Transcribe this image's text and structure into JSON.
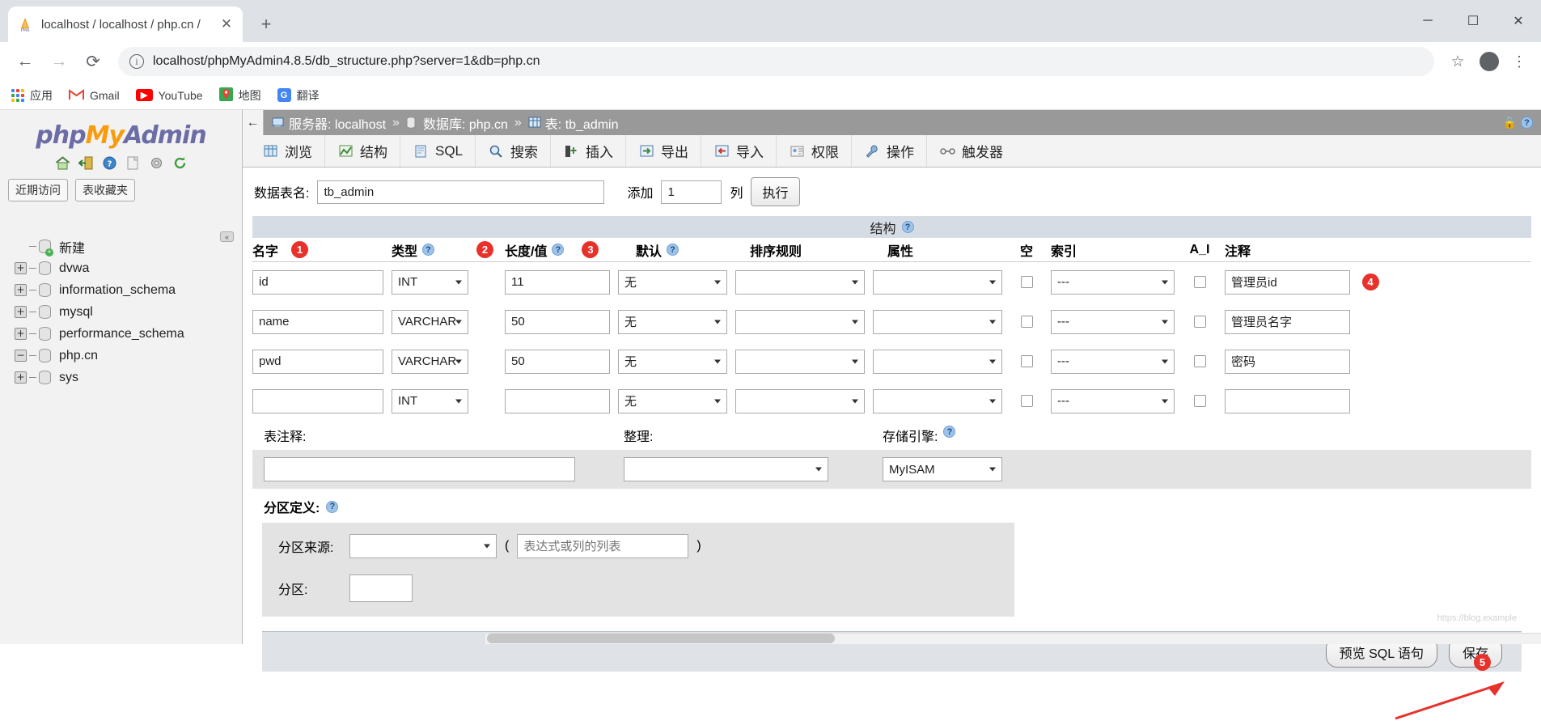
{
  "browser": {
    "tab": {
      "title": "localhost / localhost / php.cn /",
      "favicon": "pma-logo-icon",
      "close": "✕"
    },
    "new_tab": "+",
    "window_controls": {
      "minimize": "─",
      "maximize": "☐",
      "close": "✕"
    },
    "nav": {
      "back": "←",
      "forward": "→",
      "reload": "⟳"
    },
    "omnibox": {
      "info_icon": "i",
      "url_prefix": "localhost/",
      "url_rest": "phpMyAdmin4.8.5/db_structure.php?server=1&db=php.cn",
      "full_url": "localhost/phpMyAdmin4.8.5/db_structure.php?server=1&db=php.cn",
      "star": "☆"
    },
    "bookmarks": [
      {
        "label": "应用",
        "icon": "apps-grid-icon"
      },
      {
        "label": "Gmail",
        "icon": "gmail-icon"
      },
      {
        "label": "YouTube",
        "icon": "youtube-icon"
      },
      {
        "label": "地图",
        "icon": "maps-icon"
      },
      {
        "label": "翻译",
        "icon": "translate-icon"
      }
    ]
  },
  "sidebar": {
    "logo_php": "php",
    "logo_my": "My",
    "logo_admin": "Admin",
    "icons": [
      {
        "name": "home-icon",
        "glyph": "🏠"
      },
      {
        "name": "logout-icon",
        "glyph": "➡"
      },
      {
        "name": "help-icon",
        "glyph": "?"
      },
      {
        "name": "docs-icon",
        "glyph": "🗎"
      },
      {
        "name": "settings-icon",
        "glyph": "⚙"
      },
      {
        "name": "reload-icon",
        "glyph": "↻"
      }
    ],
    "buttons": [
      "近期访问",
      "表收藏夹"
    ],
    "collapse_toggle": "«",
    "tree": [
      {
        "label": "新建",
        "expander": "none",
        "icon": "db-new-icon"
      },
      {
        "label": "dvwa",
        "expander": "plus",
        "icon": "db-icon"
      },
      {
        "label": "information_schema",
        "expander": "plus",
        "icon": "db-icon"
      },
      {
        "label": "mysql",
        "expander": "plus",
        "icon": "db-icon"
      },
      {
        "label": "performance_schema",
        "expander": "plus",
        "icon": "db-icon"
      },
      {
        "label": "php.cn",
        "expander": "minus",
        "icon": "db-icon"
      },
      {
        "label": "sys",
        "expander": "plus",
        "icon": "db-icon"
      }
    ]
  },
  "breadcrumb": {
    "back": "←",
    "server_label": "服务器: localhost",
    "sep1": "»",
    "db_label": "数据库: php.cn",
    "sep2": "»",
    "table_label": "表: tb_admin",
    "lock_icon": "🔒",
    "help_icon": "?"
  },
  "tabs": [
    {
      "label": "浏览",
      "icon": "browse-icon",
      "glyph": "▤"
    },
    {
      "label": "结构",
      "icon": "structure-icon",
      "glyph": "▦"
    },
    {
      "label": "SQL",
      "icon": "sql-icon",
      "glyph": "▧"
    },
    {
      "label": "搜索",
      "icon": "search-icon",
      "glyph": "🔍"
    },
    {
      "label": "插入",
      "icon": "insert-icon",
      "glyph": "➕"
    },
    {
      "label": "导出",
      "icon": "export-icon",
      "glyph": "⬇"
    },
    {
      "label": "导入",
      "icon": "import-icon",
      "glyph": "⬆"
    },
    {
      "label": "权限",
      "icon": "privileges-icon",
      "glyph": "🪪"
    },
    {
      "label": "操作",
      "icon": "operations-icon",
      "glyph": "🔧"
    },
    {
      "label": "触发器",
      "icon": "triggers-icon",
      "glyph": "⚙"
    }
  ],
  "namebar": {
    "label": "数据表名:",
    "table_name": "tb_admin",
    "add_label": "添加",
    "add_count": "1",
    "columns_label": "列",
    "go_button": "执行"
  },
  "structure": {
    "title": "结构",
    "headers": {
      "name": "名字",
      "type": "类型",
      "length": "长度/值",
      "default": "默认",
      "collation": "排序规则",
      "attributes": "属性",
      "null": "空",
      "index": "索引",
      "ai": "A_I",
      "comments": "注释"
    },
    "rows": [
      {
        "name": "id",
        "type": "INT",
        "length": "11",
        "default": "无",
        "collation": "",
        "attributes": "",
        "null": false,
        "index": "---",
        "ai": false,
        "comment": "管理员id"
      },
      {
        "name": "name",
        "type": "VARCHAR",
        "length": "50",
        "default": "无",
        "collation": "",
        "attributes": "",
        "null": false,
        "index": "---",
        "ai": false,
        "comment": "管理员名字"
      },
      {
        "name": "pwd",
        "type": "VARCHAR",
        "length": "50",
        "default": "无",
        "collation": "",
        "attributes": "",
        "null": false,
        "index": "---",
        "ai": false,
        "comment": "密码"
      },
      {
        "name": "",
        "type": "INT",
        "length": "",
        "default": "无",
        "collation": "",
        "attributes": "",
        "null": false,
        "index": "---",
        "ai": false,
        "comment": ""
      }
    ]
  },
  "table_meta": {
    "comment_label": "表注释:",
    "comment_value": "",
    "collation_label": "整理:",
    "collation_value": "",
    "engine_label": "存储引擎:",
    "engine_value": "MyISAM"
  },
  "partition": {
    "title": "分区定义:",
    "source_label": "分区来源:",
    "source_value": "",
    "paren_open": "(",
    "expr_placeholder": "表达式或列的列表",
    "paren_close": ")",
    "partitions_label": "分区:",
    "partitions_value": ""
  },
  "footer": {
    "preview_sql": "预览 SQL 语句",
    "save": "保存"
  },
  "annotations": [
    {
      "id": "1",
      "target": "name-column-header"
    },
    {
      "id": "2",
      "target": "type-column-header"
    },
    {
      "id": "3",
      "target": "length-column-header"
    },
    {
      "id": "4",
      "target": "comment-field-row-1"
    },
    {
      "id": "5",
      "target": "save-button"
    }
  ],
  "colors": {
    "badge_red": "#e8312a",
    "breadcrumb_bg": "#999999",
    "struct_header_bg": "#d6dce3",
    "logo_blue": "#6c6ca6",
    "logo_orange": "#f89c0e"
  }
}
